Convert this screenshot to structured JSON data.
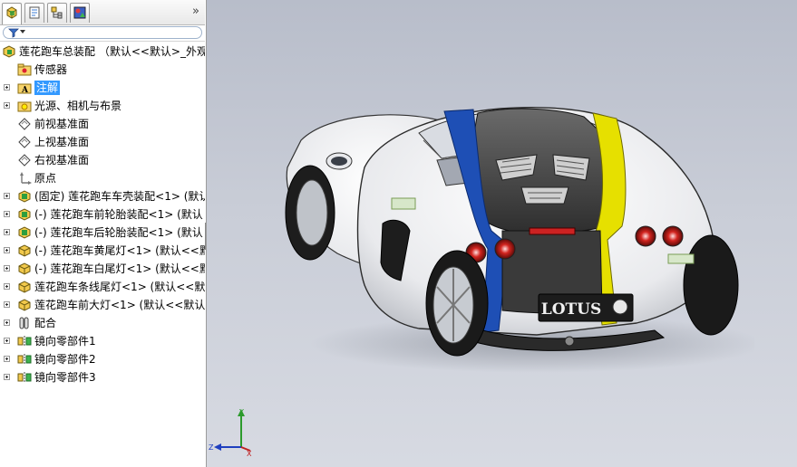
{
  "colors": {
    "selection": "#3399ff",
    "viewport_top": "#b8bdca",
    "viewport_bottom": "#d7dae2",
    "stripe_blue": "#1e4fb5",
    "stripe_yellow": "#e6e000",
    "body_white": "#f2f3f5"
  },
  "panel": {
    "tabs": [
      {
        "icon": "feature-manager-icon"
      },
      {
        "icon": "property-manager-icon"
      },
      {
        "icon": "configuration-manager-icon"
      },
      {
        "icon": "display-manager-icon"
      }
    ],
    "more_glyph": "»",
    "filter_icon": "filter-icon"
  },
  "tree": [
    {
      "label": "莲花跑车总装配 （默认<<默认>_外观",
      "icon": "assembly-icon",
      "expander": false,
      "indent": 0
    },
    {
      "label": "传感器",
      "icon": "sensor-folder-icon",
      "expander": false,
      "indent": 1
    },
    {
      "label": "注解",
      "icon": "annotation-icon",
      "expander": true,
      "indent": 1,
      "selected": true
    },
    {
      "label": "光源、相机与布景",
      "icon": "lights-camera-icon",
      "expander": true,
      "indent": 1
    },
    {
      "label": "前视基准面",
      "icon": "plane-icon",
      "expander": false,
      "indent": 1
    },
    {
      "label": "上视基准面",
      "icon": "plane-icon",
      "expander": false,
      "indent": 1
    },
    {
      "label": "右视基准面",
      "icon": "plane-icon",
      "expander": false,
      "indent": 1
    },
    {
      "label": "原点",
      "icon": "origin-icon",
      "expander": false,
      "indent": 1
    },
    {
      "label": "(固定) 莲花跑车车壳装配<1> (默认",
      "icon": "subassembly-icon",
      "expander": true,
      "indent": 1
    },
    {
      "label": "(-) 莲花跑车前轮胎装配<1> (默认",
      "icon": "subassembly-icon",
      "expander": true,
      "indent": 1
    },
    {
      "label": "(-) 莲花跑车后轮胎装配<1> (默认",
      "icon": "subassembly-icon",
      "expander": true,
      "indent": 1
    },
    {
      "label": "(-) 莲花跑车黄尾灯<1> (默认<<默",
      "icon": "part-icon",
      "expander": true,
      "indent": 1
    },
    {
      "label": "(-) 莲花跑车白尾灯<1> (默认<<默",
      "icon": "part-icon",
      "expander": true,
      "indent": 1
    },
    {
      "label": "莲花跑车条线尾灯<1> (默认<<默认",
      "icon": "part-icon",
      "expander": true,
      "indent": 1
    },
    {
      "label": "莲花跑车前大灯<1> (默认<<默认",
      "icon": "part-icon",
      "expander": true,
      "indent": 1
    },
    {
      "label": "配合",
      "icon": "mates-icon",
      "expander": true,
      "indent": 1
    },
    {
      "label": "镜向零部件1",
      "icon": "mirror-component-icon",
      "expander": true,
      "indent": 1
    },
    {
      "label": "镜向零部件2",
      "icon": "mirror-component-icon",
      "expander": true,
      "indent": 1
    },
    {
      "label": "镜向零部件3",
      "icon": "mirror-component-icon",
      "expander": true,
      "indent": 1
    }
  ],
  "viewport": {
    "model_brand": "LOTUS",
    "rear_lettering": "LOTUS",
    "triad": {
      "x": "X",
      "y": "Y",
      "z": "Z"
    }
  }
}
